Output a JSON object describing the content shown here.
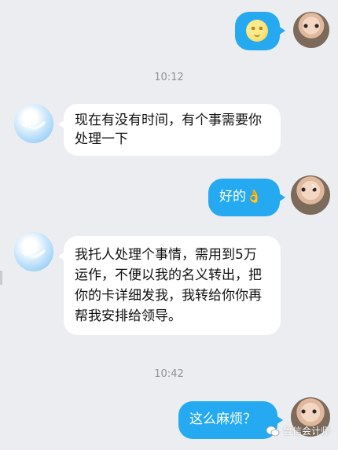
{
  "messages": [
    {
      "sender": "self",
      "type": "emoji",
      "emoji": "full-moon-face"
    },
    {
      "type": "time",
      "text": "10:12"
    },
    {
      "sender": "contact",
      "text": "现在有没有时间，有个事需要你处理一下"
    },
    {
      "sender": "self",
      "text": "好的",
      "emoji": "👌"
    },
    {
      "sender": "contact",
      "text": "我托人处理个事情，需用到5万运作，不便以我的名义转出，把你的卡详细发我，我转给你你再帮我安排给领导。"
    },
    {
      "type": "time",
      "text": "10:42"
    },
    {
      "sender": "self",
      "text": "这么麻烦？"
    }
  ],
  "watermark": "鲁信会计师",
  "colors": {
    "background": "#ebedf0",
    "self_bubble": "#25aaf2",
    "other_bubble": "#ffffff",
    "timestamp": "#8f9296"
  }
}
